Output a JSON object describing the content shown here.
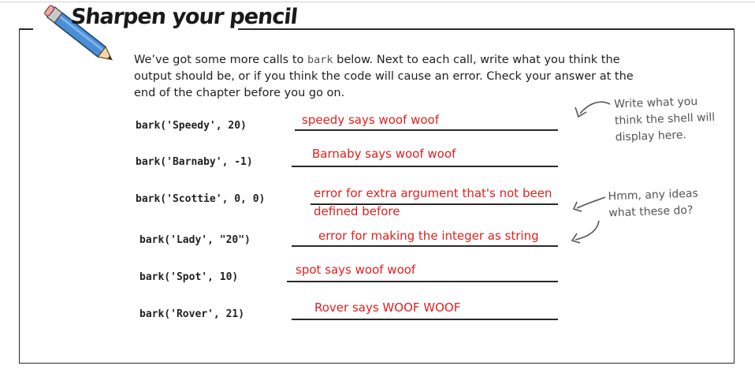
{
  "title": "Sharpen your pencil",
  "instructions": {
    "before_code": "We’ve got some more calls to ",
    "code": "bark",
    "after_code": " below. Next to each call, write what you think the output should be, or if you think the code will cause an error. Check your answer at the end of the chapter before you go on."
  },
  "notes": {
    "shell": "Write what you think the shell will display here.",
    "ideas": "Hmm, any ideas what these do?"
  },
  "calls": [
    {
      "code": "bark('Speedy', 20)",
      "answer": "speedy says woof woof"
    },
    {
      "code": "bark('Barnaby', -1)",
      "answer": "Barnaby says woof woof"
    },
    {
      "code": "bark('Scottie', 0, 0)",
      "answer_line1": "error for extra argument that's not been",
      "answer_line2": "defined before"
    },
    {
      "code": "bark('Lady', \"20\")",
      "answer": "error for making the integer as string"
    },
    {
      "code": "bark('Spot', 10)",
      "answer": "spot says woof woof"
    },
    {
      "code": "bark('Rover', 21)",
      "answer": "Rover says WOOF WOOF"
    }
  ],
  "colors": {
    "answer": "#e02020",
    "frame": "#2a2a2a",
    "note": "#555555"
  }
}
